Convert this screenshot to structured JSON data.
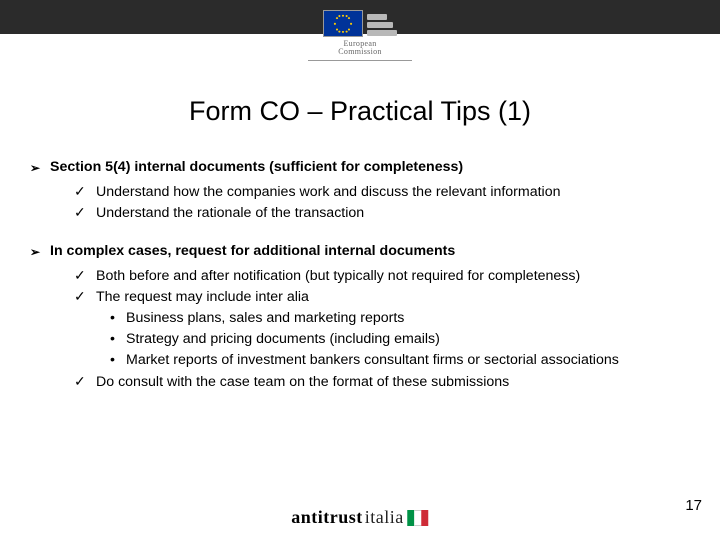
{
  "header": {
    "logo_line1": "European",
    "logo_line2": "Commission"
  },
  "title": "Form CO – Practical Tips (1)",
  "sections": [
    {
      "heading": "Section 5(4) internal documents (sufficient for completeness)",
      "items": [
        {
          "text": "Understand how the companies work and discuss the relevant information"
        },
        {
          "text": "Understand the rationale of the transaction"
        }
      ]
    },
    {
      "heading": "In complex cases, request for additional internal documents",
      "items": [
        {
          "text": "Both before and after notification (but typically not required for completeness)"
        },
        {
          "text": "The request may include inter alia",
          "subitems": [
            "Business plans, sales and marketing reports",
            "Strategy and pricing documents (including emails)",
            "Market reports of investment bankers consultant firms or sectorial associations"
          ]
        },
        {
          "text": "Do consult with the case team on the format of these submissions"
        }
      ]
    }
  ],
  "page_number": "17",
  "footer": {
    "part1": "antitrust",
    "part2": "italia"
  }
}
